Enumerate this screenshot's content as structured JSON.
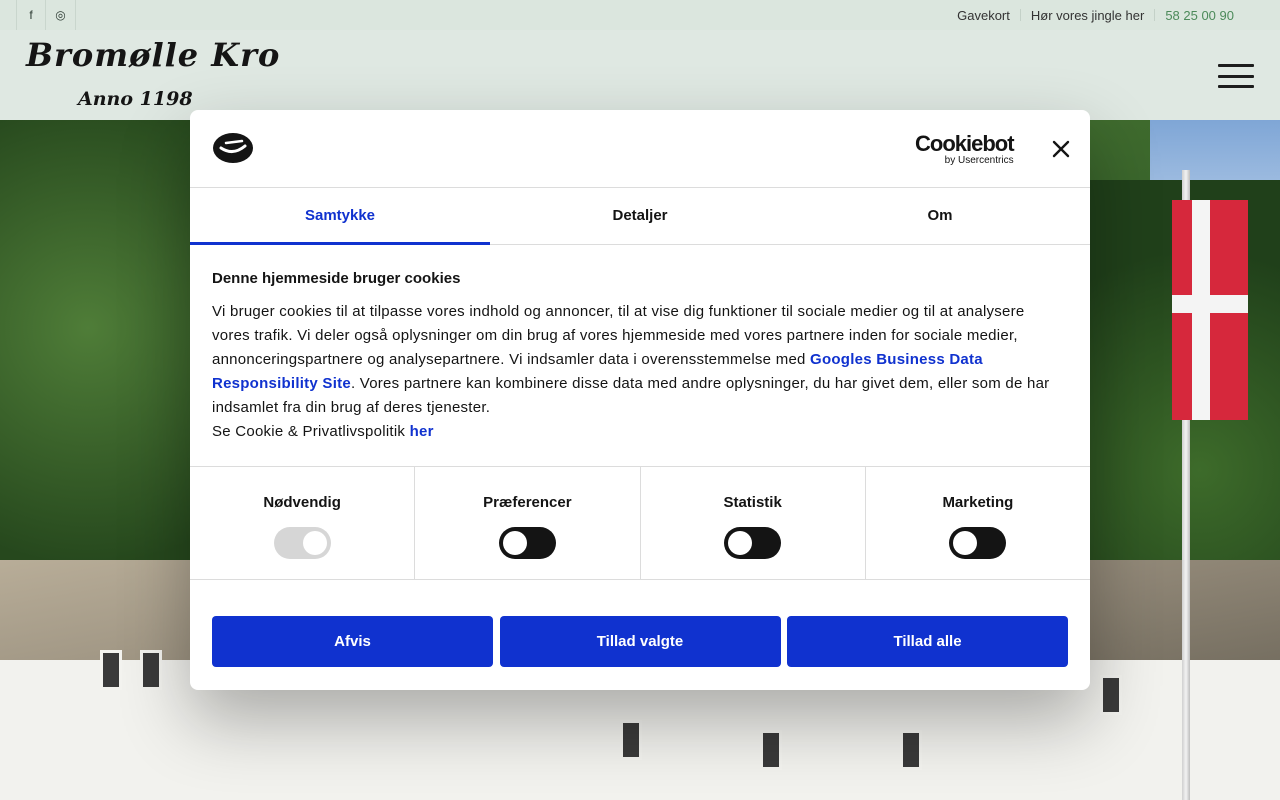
{
  "topbar": {
    "social": [
      {
        "icon": "facebook-icon",
        "glyph": "f"
      },
      {
        "icon": "instagram-icon",
        "glyph": "◎"
      }
    ],
    "links": [
      "Gavekort",
      "Hør vores jingle her"
    ],
    "phone": "58 25 00 90"
  },
  "header": {
    "logo_title": "Bromølle Kro",
    "logo_sub": "Anno 1198"
  },
  "dialog": {
    "brand_name": "Cookiebot",
    "brand_sub": "by Usercentrics",
    "tabs": [
      "Samtykke",
      "Detaljer",
      "Om"
    ],
    "active_tab": "Samtykke",
    "heading": "Denne hjemmeside bruger cookies",
    "body_part1": "Vi bruger cookies til at tilpasse vores indhold og annoncer, til at vise dig funktioner til sociale medier og til at analysere vores trafik. Vi deler også oplysninger om din brug af vores hjemmeside med vores partnere inden for sociale medier, annonceringspartnere og analysepartnere. Vi indsamler data i overensstemmelse med ",
    "body_link": "Googles Business Data Responsibility Site",
    "body_part2": ". Vores partnere kan kombinere disse data med andre oplysninger, du har givet dem, eller som de har indsamlet fra din brug af deres tjenester.",
    "policy_text": "Se Cookie & Privatlivspolitik ",
    "policy_link": "her",
    "toggles": [
      {
        "label": "Nødvendig",
        "on": true,
        "disabled": true
      },
      {
        "label": "Præferencer",
        "on": false
      },
      {
        "label": "Statistik",
        "on": false
      },
      {
        "label": "Marketing",
        "on": false
      }
    ],
    "buttons": {
      "deny": "Afvis",
      "allow_selected": "Tillad valgte",
      "allow_all": "Tillad alle"
    }
  },
  "colors": {
    "accent": "#1032cf",
    "phone": "#4c8a5a"
  }
}
